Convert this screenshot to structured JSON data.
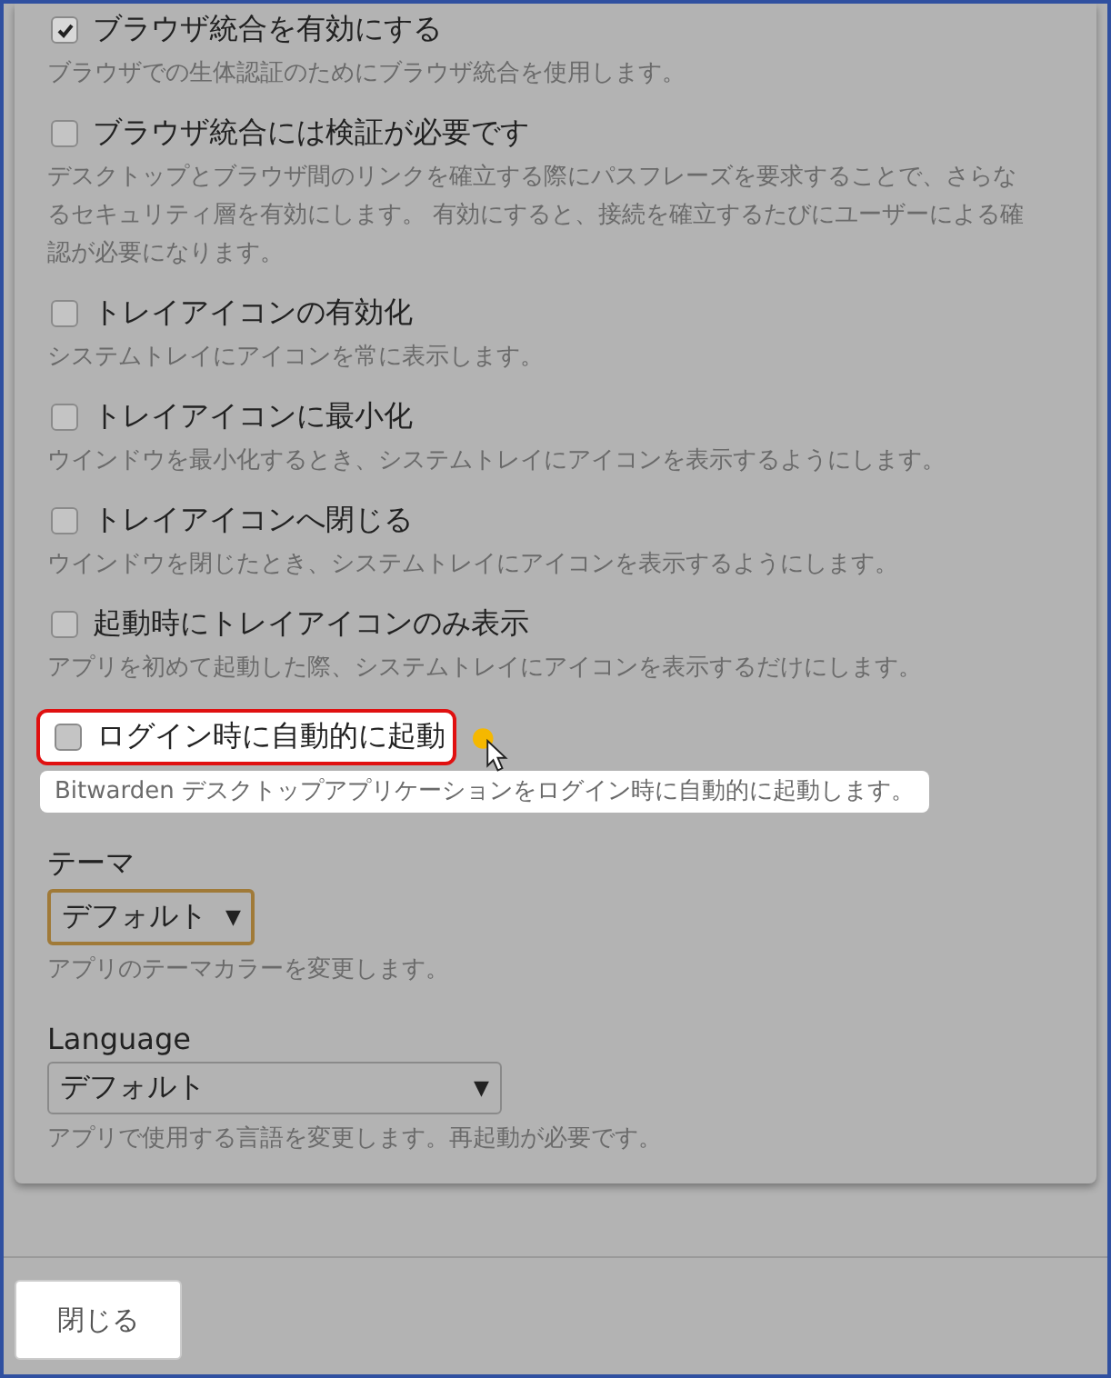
{
  "options": [
    {
      "label": "ブラウザ統合を有効にする",
      "checked": true,
      "highlighted": false,
      "description": "ブラウザでの生体認証のためにブラウザ統合を使用します。"
    },
    {
      "label": "ブラウザ統合には検証が必要です",
      "checked": false,
      "highlighted": false,
      "description": "デスクトップとブラウザ間のリンクを確立する際にパスフレーズを要求することで、さらなるセキュリティ層を有効にします。 有効にすると、接続を確立するたびにユーザーによる確認が必要になります。"
    },
    {
      "label": "トレイアイコンの有効化",
      "checked": false,
      "highlighted": false,
      "description": "システムトレイにアイコンを常に表示します。"
    },
    {
      "label": "トレイアイコンに最小化",
      "checked": false,
      "highlighted": false,
      "description": "ウインドウを最小化するとき、システムトレイにアイコンを表示するようにします。"
    },
    {
      "label": "トレイアイコンへ閉じる",
      "checked": false,
      "highlighted": false,
      "description": "ウインドウを閉じたとき、システムトレイにアイコンを表示するようにします。"
    },
    {
      "label": "起動時にトレイアイコンのみ表示",
      "checked": false,
      "highlighted": false,
      "description": "アプリを初めて起動した際、システムトレイにアイコンを表示するだけにします。"
    },
    {
      "label": "ログイン時に自動的に起動",
      "checked": false,
      "highlighted": true,
      "description": "Bitwarden デスクトップアプリケーションをログイン時に自動的に起動します。"
    }
  ],
  "selects": [
    {
      "label": "テーマ",
      "value": "デフォルト",
      "focused": true,
      "description": "アプリのテーマカラーを変更します。"
    },
    {
      "label": "Language",
      "value": "デフォルト",
      "focused": false,
      "description": "アプリで使用する言語を変更します。再起動が必要です。"
    }
  ],
  "caret": "▼",
  "close_button": "閉じる"
}
